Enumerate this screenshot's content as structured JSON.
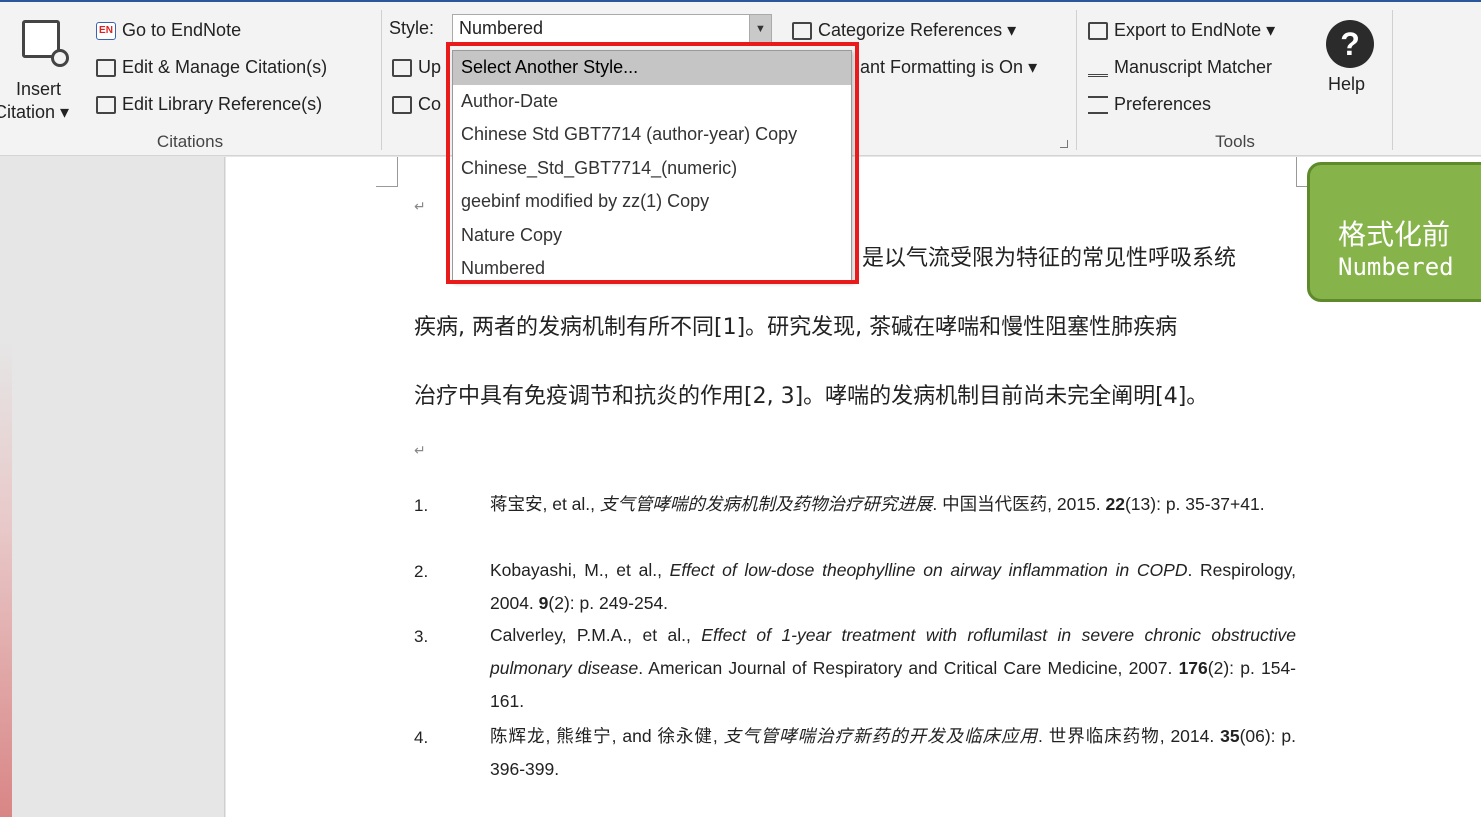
{
  "ribbon": {
    "citations": {
      "insert_line1": "Insert",
      "insert_line2": "Citation ▾",
      "go_to_endnote": "Go to EndNote",
      "edit_manage": "Edit & Manage Citation(s)",
      "edit_library": "Edit Library Reference(s)",
      "group_label": "Citations"
    },
    "bibliography": {
      "style_label": "Style:",
      "style_value": "Numbered",
      "update_partial": "Up",
      "convert_partial": "Co",
      "categorize": "Categorize References ▾",
      "instant_formatting": "ant Formatting is On ▾"
    },
    "tools": {
      "export": "Export to EndNote ▾",
      "manuscript": "Manuscript Matcher",
      "preferences": "Preferences",
      "group_label": "Tools"
    },
    "help": {
      "icon": "?",
      "label": "Help"
    }
  },
  "style_dropdown": {
    "items": [
      "Select Another Style...",
      "Author-Date",
      "Chinese Std GBT7714 (author-year) Copy",
      "Chinese_Std_GBT7714_(numeric)",
      "geebinf modified by zz(1) Copy",
      "Nature Copy",
      "Numbered"
    ],
    "selected_index": 0
  },
  "document": {
    "para1_tail": "是以气流受限为特征的常见性呼吸系统",
    "para2": "疾病, 两者的发病机制有所不同[1]。研究发现, 茶碱在哮喘和慢性阻塞性肺疾病",
    "para3": "治疗中具有免疫调节和抗炎的作用[2, 3]。哮喘的发病机制目前尚未完全阐明[4]。",
    "references": [
      {
        "num": "1.",
        "author": "蒋宝安, et al., ",
        "title": "支气管哮喘的发病机制及药物治疗研究进展",
        "journal": ". 中国当代医药, 2015. ",
        "vol": "22",
        "rest": "(13): p. 35-37+41."
      },
      {
        "num": "2.",
        "author": "Kobayashi, M., et al., ",
        "title": "Effect of low-dose theophylline on airway inflammation in COPD",
        "journal": ". Respirology, 2004. ",
        "vol": "9",
        "rest": "(2): p. 249-254."
      },
      {
        "num": "3.",
        "author": "Calverley, P.M.A., et al., ",
        "title": "Effect of 1-year treatment with roflumilast in severe chronic obstructive pulmonary disease",
        "journal": ". American Journal of Respiratory and Critical Care Medicine, 2007. ",
        "vol": "176",
        "rest": "(2): p. 154-161."
      },
      {
        "num": "4.",
        "author": "陈辉龙, 熊维宁, and 徐永健, ",
        "title": "支气管哮喘治疗新药的开发及临床应用",
        "journal": ". 世界临床药物, 2014. ",
        "vol": "35",
        "rest": "(06): p. 396-399."
      }
    ]
  },
  "callout": {
    "line1": "格式化前",
    "line2": "Numbered"
  },
  "colors": {
    "highlight_border": "#e81a1a",
    "callout_fill": "#86b44b",
    "callout_border": "#5f8a2c"
  }
}
